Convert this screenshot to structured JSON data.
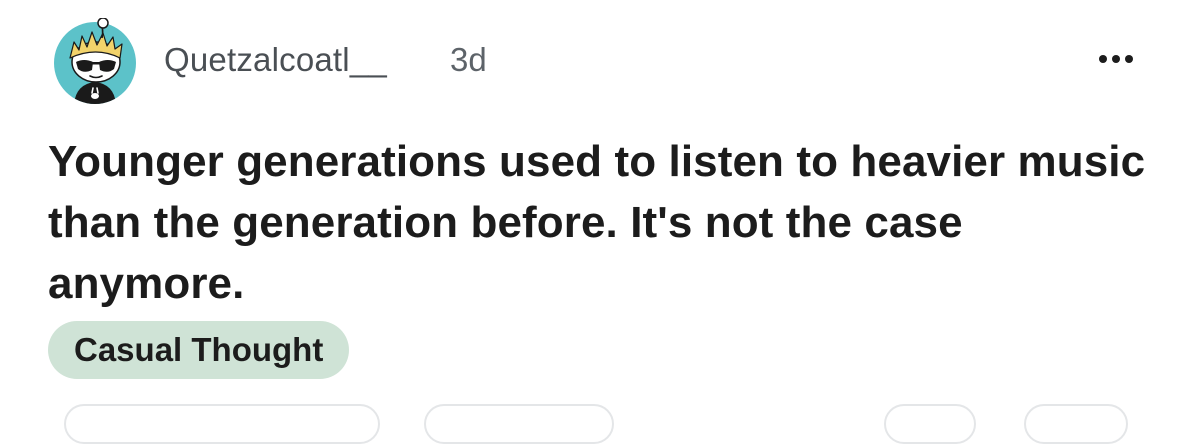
{
  "post": {
    "username": "Quetzalcoatl__",
    "age": "3d",
    "title": "Younger generations used to listen to heavier music than the generation before. It's not the case anymore.",
    "flair": "Casual Thought",
    "more_icon": "more-horizontal-icon",
    "avatar_icon": "reddit-snoo-avatar"
  },
  "colors": {
    "avatar_bg": "#5cc2c9",
    "flair_bg": "#cfe3d6",
    "text": "#1c1c1c",
    "meta_text": "#4a4f54"
  }
}
